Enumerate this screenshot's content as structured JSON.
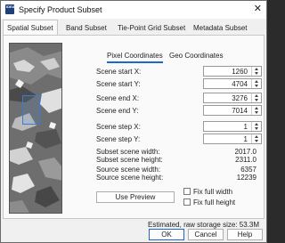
{
  "window": {
    "title": "Specify Product Subset",
    "close_glyph": "✕",
    "app_icon_text": "IDEA"
  },
  "tabs": [
    {
      "label": "Spatial Subset",
      "active": true
    },
    {
      "label": "Band Subset",
      "active": false
    },
    {
      "label": "Tie-Point Grid Subset",
      "active": false
    },
    {
      "label": "Metadata Subset",
      "active": false
    }
  ],
  "subtabs": [
    {
      "label": "Pixel Coordinates",
      "active": true
    },
    {
      "label": "Geo Coordinates",
      "active": false
    }
  ],
  "fields": {
    "scene_start_x": {
      "label": "Scene start X:",
      "value": "1260"
    },
    "scene_start_y": {
      "label": "Scene start Y:",
      "value": "4704"
    },
    "scene_end_x": {
      "label": "Scene end X:",
      "value": "3276"
    },
    "scene_end_y": {
      "label": "Scene end Y:",
      "value": "7014"
    },
    "scene_step_x": {
      "label": "Scene step X:",
      "value": "1"
    },
    "scene_step_y": {
      "label": "Scene step Y:",
      "value": "1"
    }
  },
  "info": {
    "subset_width": {
      "label": "Subset scene width:",
      "value": "2017.0"
    },
    "subset_height": {
      "label": "Subset scene height:",
      "value": "2311.0"
    },
    "source_width": {
      "label": "Source scene width:",
      "value": "6357"
    },
    "source_height": {
      "label": "Source scene height:",
      "value": "12239"
    }
  },
  "controls": {
    "use_preview": "Use Preview",
    "fix_full_width": "Fix full width",
    "fix_full_height": "Fix full height"
  },
  "status": {
    "storage": "Estimated, raw storage size: 53.3M"
  },
  "footer": {
    "ok": "OK",
    "cancel": "Cancel",
    "help": "Help"
  },
  "colors": {
    "accent": "#1e66d0",
    "roi": "#3a7bd5"
  }
}
